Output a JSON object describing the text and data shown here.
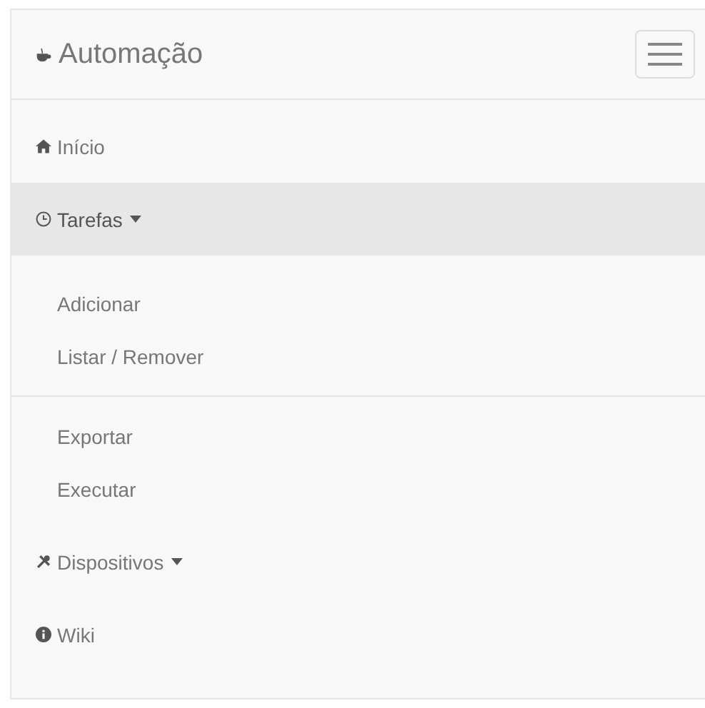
{
  "brand": "Automação",
  "nav": [
    {
      "label": "Início",
      "kind": "link"
    },
    {
      "label": "Tarefas",
      "kind": "dropdown",
      "expanded": true,
      "children": [
        {
          "kind": "item",
          "label": "Adicionar"
        },
        {
          "kind": "item",
          "label": "Listar / Remover"
        },
        {
          "kind": "divider"
        },
        {
          "kind": "item",
          "label": "Exportar"
        },
        {
          "kind": "item",
          "label": "Executar"
        }
      ]
    },
    {
      "label": "Dispositivos",
      "kind": "dropdown",
      "expanded": false
    },
    {
      "label": "Wiki",
      "kind": "link"
    }
  ]
}
